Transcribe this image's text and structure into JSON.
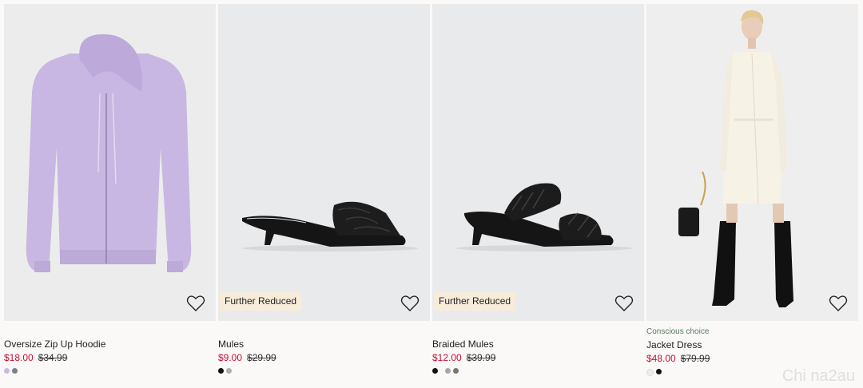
{
  "products": [
    {
      "name": "Oversize Zip Up Hoodie",
      "price": "$18.00",
      "original_price": "$34.99",
      "badge": "",
      "label": "",
      "swatches": [
        "#c9b8e6",
        "#7a7f8c"
      ]
    },
    {
      "name": "Mules",
      "price": "$9.00",
      "original_price": "$29.99",
      "badge": "Further Reduced",
      "label": "",
      "swatches": [
        "#111111",
        "#b0adab"
      ]
    },
    {
      "name": "Braided Mules",
      "price": "$12.00",
      "original_price": "$39.99",
      "badge": "Further Reduced",
      "label": "",
      "swatches": [
        "#111111",
        "#a8a4a8",
        "#7d7368"
      ]
    },
    {
      "name": "Jacket Dress",
      "price": "$48.00",
      "original_price": "$79.99",
      "badge": "",
      "label": "Conscious choice",
      "swatches": [
        "#f1ede6",
        "#111111"
      ]
    }
  ],
  "watermark": "Chi na2au",
  "colors": {
    "sale": "#c90d34",
    "badge_bg": "#f7ecda",
    "conscious": "#5b7a5e"
  }
}
